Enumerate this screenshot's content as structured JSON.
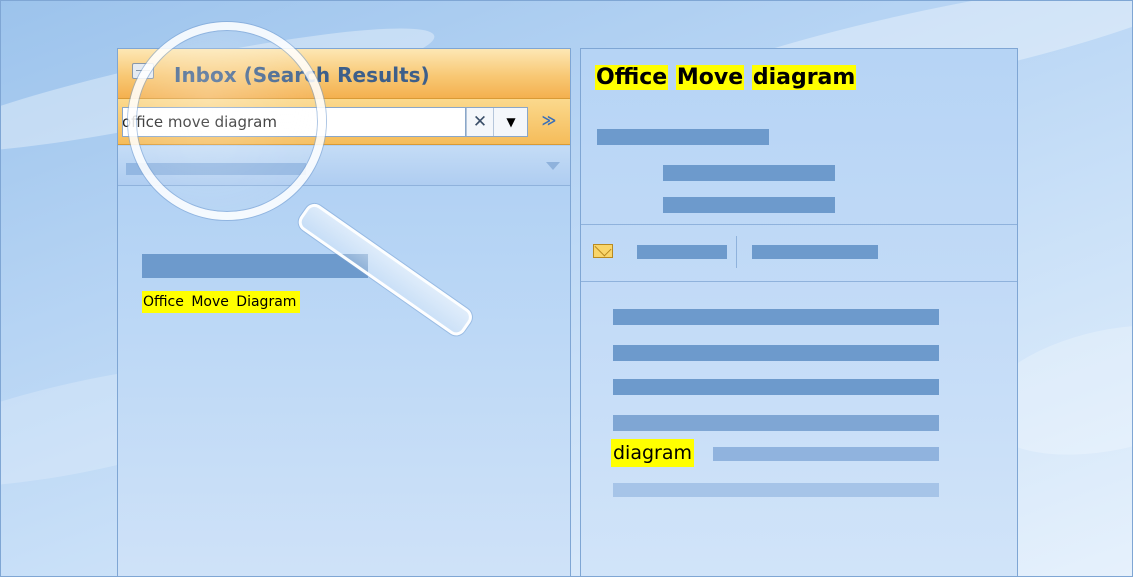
{
  "left_pane": {
    "title": "Inbox (Search Results)",
    "search": {
      "value": "office move diagram",
      "clear_glyph": "✕",
      "dropdown_glyph": "▼",
      "expand_glyph": "≫"
    },
    "result": {
      "subject": "Office Move Diagram"
    }
  },
  "reading_pane": {
    "subject_words": [
      "Office",
      "Move",
      "diagram"
    ],
    "body_keyword": "diagram"
  },
  "icons": {
    "inbox": "inbox-icon",
    "magnifier": "magnifying-glass-icon",
    "mail": "envelope-icon"
  },
  "colors": {
    "highlight": "#ffff00",
    "header_orange": "#f8c874",
    "pane_blue": "#b6d4f5",
    "title_blue": "#3d5f8a"
  }
}
